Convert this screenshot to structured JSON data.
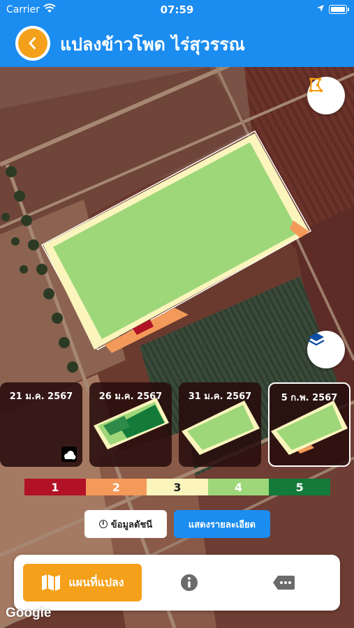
{
  "status_bar": {
    "carrier": "Carrier",
    "time": "07:59"
  },
  "header": {
    "title": "แปลงข้าวโพด ไร่สุวรรณ",
    "back_icon": "back-chevron-icon"
  },
  "map": {
    "draw_button_icon": "draw-polygon-icon",
    "layers_button_icon": "layers-icon",
    "attribution": "Google"
  },
  "thumbnails": [
    {
      "date": "21 ม.ค. 2567",
      "state": "cloud",
      "selected": false
    },
    {
      "date": "26 ม.ค. 2567",
      "state": "index",
      "selected": false
    },
    {
      "date": "31 ม.ค. 2567",
      "state": "index",
      "selected": false
    },
    {
      "date": "5 ก.พ. 2567",
      "state": "index",
      "selected": true
    }
  ],
  "legend": [
    {
      "label": "1",
      "color": "#b11226",
      "text_color": "#ffffff"
    },
    {
      "label": "2",
      "color": "#f39a5a",
      "text_color": "#ffffff"
    },
    {
      "label": "3",
      "color": "#fbf5bd",
      "text_color": "#222222"
    },
    {
      "label": "4",
      "color": "#9ed77a",
      "text_color": "#ffffff"
    },
    {
      "label": "5",
      "color": "#137a3a",
      "text_color": "#ffffff"
    }
  ],
  "buttons": {
    "index_info": "ข้อมูลดัชนี",
    "show_details": "แสดงรายละเอียด"
  },
  "bottom_nav": {
    "map_tab": "แผนที่แปลง",
    "info_icon": "info-icon",
    "more_icon": "more-tag-icon"
  },
  "colors": {
    "primary": "#1b8cf0",
    "accent": "#f5a01a"
  }
}
